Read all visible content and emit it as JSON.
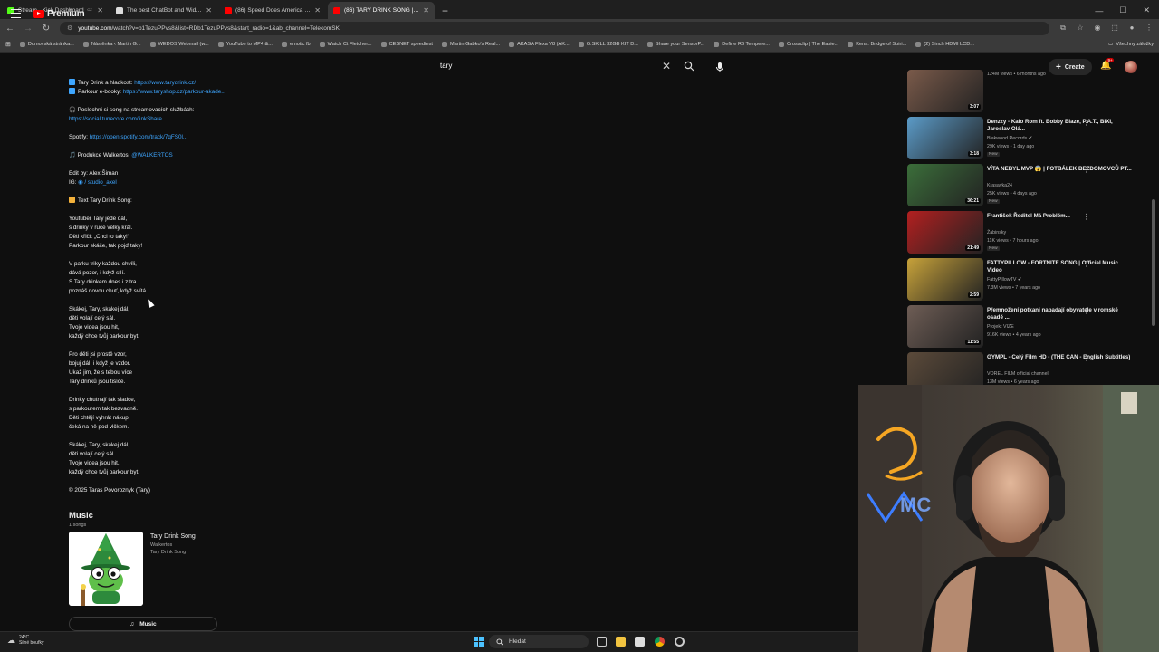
{
  "browser": {
    "tabs": [
      {
        "title": "Stream - Kick Dashboard",
        "color": "#53fc18",
        "active": false
      },
      {
        "title": "The best ChatBot and Widgets",
        "color": "#dddddd",
        "active": false
      },
      {
        "title": "(86) Speed Does America us De...",
        "color": "#ff0000",
        "active": false
      },
      {
        "title": "(86) TARY DRINK SONG | Offici...",
        "color": "#ff0000",
        "active": true
      }
    ],
    "url_host": "youtube.com",
    "url_path": "/watch?v=b1TezuPPvs8&list=RDb1TezuPPvs8&start_radio=1&ab_channel=TelekomSK",
    "bookmarks": [
      "Domovská stránka...",
      "Nástěnka ‹ Martin G...",
      "WEDOS Webmail (w...",
      "YouTube to MP4 &...",
      "emotic fb",
      "Watch Ct Fletcher...",
      "CESNET speedtest",
      "Martin Gabko's Real...",
      "AKASA Flexa V8 (AK...",
      "G.SKILL 32GB KIT D...",
      "Share your SensorP...",
      "Define R6 Tempere...",
      "Crossclip | The Easie...",
      "Kena: Bridge of Spiri...",
      "(2) Sinch HDMI LCD..."
    ],
    "bookmarks_folder": "Všechny záložky"
  },
  "youtube": {
    "logo_text": "Premium",
    "logo_sup": "CZ",
    "search_value": "tary",
    "create_label": "Create",
    "notif_count": "9+"
  },
  "description": {
    "lines": [
      {
        "text": "Tary Drink a hladkost: ",
        "link": "https://www.tarydrink.cz/",
        "emoji": "#3ea6ff"
      },
      {
        "text": "Parkour e-booky: ",
        "link": "https://www.taryshop.cz/parkour-akade...",
        "emoji": "#3ea6ff"
      },
      {
        "text": ""
      },
      {
        "text": "🎧 Poslechni si song na streamovacích službách:"
      },
      {
        "text": "",
        "link": "https://social.tunecore.com/linkShare..."
      },
      {
        "text": ""
      },
      {
        "text": "Spotify: ",
        "link": "https://open.spotify.com/track/7qFS0l..."
      },
      {
        "text": ""
      },
      {
        "text": "🎵 Produkce Walkertos: ",
        "link": "@WALKERTOS"
      },
      {
        "text": ""
      },
      {
        "text": "Edit by: Alex Šiman"
      },
      {
        "text": "IG: ",
        "link": "◉ / studio_axel"
      },
      {
        "text": ""
      },
      {
        "text": "Text Tary Drink Song:",
        "emoji": "#f3b13b"
      },
      {
        "text": ""
      },
      {
        "text": "Youtuber Tary jede dál,"
      },
      {
        "text": "s drinky v ruce velký král."
      },
      {
        "text": "Děti křičí: „Chci to taky!“"
      },
      {
        "text": "Parkour skáče, tak pojď taky!"
      },
      {
        "text": ""
      },
      {
        "text": "V parku triky každou chvíli,"
      },
      {
        "text": "dává pozor, i když sílí."
      },
      {
        "text": "S Tary drinkem dnes i zítra"
      },
      {
        "text": "poznáš novou chuť, když svítá."
      },
      {
        "text": ""
      },
      {
        "text": "Skákej, Tary, skákej dál,"
      },
      {
        "text": "děti volají celý sál."
      },
      {
        "text": "Tvoje videa jsou hit,"
      },
      {
        "text": "každý chce tvůj parkour byt."
      },
      {
        "text": ""
      },
      {
        "text": "Pro děti jsi prostě vzor,"
      },
      {
        "text": "bojuj dál, i když je vzdor."
      },
      {
        "text": "Ukaž jim, že s tebou více"
      },
      {
        "text": "Tary drinků jsou tisíce."
      },
      {
        "text": ""
      },
      {
        "text": "Drinky chutnají tak sladce,"
      },
      {
        "text": "s parkourem tak bezvadně."
      },
      {
        "text": "Děti chtějí vyhrát nákup,"
      },
      {
        "text": "čeká na ně pod vlčkem."
      },
      {
        "text": ""
      },
      {
        "text": "Skákej, Tary, skákej dál,"
      },
      {
        "text": "děti volají celý sál."
      },
      {
        "text": "Tvoje videa jsou hit,"
      },
      {
        "text": "každý chce tvůj parkour byt."
      },
      {
        "text": ""
      },
      {
        "text": "© 2025 Taras Povoroznyk (Tary)"
      }
    ]
  },
  "music": {
    "heading": "Music",
    "count": "1 songs",
    "song_title": "Tary Drink Song",
    "artist": "Walkertos",
    "album": "Tary Drink Song",
    "button_label": "Music"
  },
  "recommendations": [
    {
      "title": "",
      "channel": "",
      "views": "124M views • 6 months ago",
      "duration": "3:07",
      "new": false,
      "verified": false,
      "thumb": "#7a5a4a"
    },
    {
      "title": "Denzzy - Kalo Rom ft. Bobby Blaze, P.A.T., BIXI, Jaroslav Olá...",
      "channel": "Blakwood Records",
      "views": "29K views • 1 day ago",
      "duration": "3:18",
      "new": true,
      "verified": true,
      "thumb": "#5b9bc8"
    },
    {
      "title": "VÍTA NEBYL MVP 😱 | FOTBÁLEK BEZDOMOVCŮ PT...",
      "channel": "Krasavka24",
      "views": "25K views • 4 days ago",
      "duration": "36:21",
      "new": true,
      "verified": false,
      "thumb": "#3b6e3a"
    },
    {
      "title": "František Ředitel Má Problém...",
      "channel": "Žabinsky",
      "views": "11K views • 7 hours ago",
      "duration": "21:49",
      "new": true,
      "verified": false,
      "thumb": "#b22020"
    },
    {
      "title": "FATTYPILLOW - FORTNITE SONG | Official Music Video",
      "channel": "FattyPillowTV",
      "views": "7.3M views • 7 years ago",
      "duration": "2:59",
      "new": false,
      "verified": true,
      "thumb": "#c7a23a"
    },
    {
      "title": "Přemnožení potkani napadají obyvatele v romské osadě ...",
      "channel": "Projekt VIZE",
      "views": "916K views • 4 years ago",
      "duration": "11:55",
      "new": false,
      "verified": false,
      "thumb": "#6e5d55"
    },
    {
      "title": "GYMPL - Celý Film HD - (THE CAN - English Subtitles)",
      "channel": "VOREL FILM official channel",
      "views": "13M views • 6 years ago",
      "duration": "1:49:04",
      "new": false,
      "verified": false,
      "thumb": "#5b4a3a"
    }
  ],
  "new_label": "New",
  "taskbar": {
    "temperature": "24°C",
    "weather_desc": "Silné bouřky",
    "search_placeholder": "Hledat"
  },
  "overlay": {
    "webcam_sign_text": "MC"
  }
}
